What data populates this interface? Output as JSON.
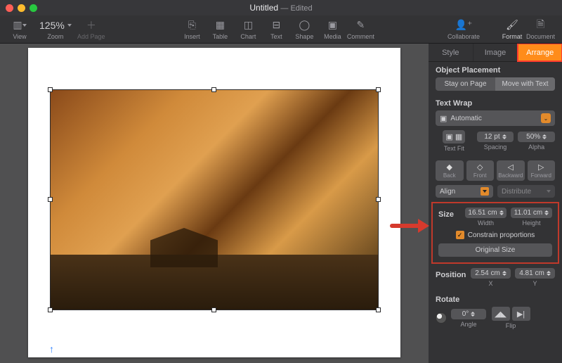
{
  "title": {
    "name": "Untitled",
    "status": "Edited"
  },
  "toolbar": {
    "view": "View",
    "zoom": "Zoom",
    "zoom_value": "125%",
    "add_page": "Add Page",
    "insert": "Insert",
    "table": "Table",
    "chart": "Chart",
    "text": "Text",
    "shape": "Shape",
    "media": "Media",
    "comment": "Comment",
    "collaborate": "Collaborate",
    "format": "Format",
    "document": "Document"
  },
  "inspector": {
    "tabs": {
      "style": "Style",
      "image": "Image",
      "arrange": "Arrange"
    },
    "object_placement": {
      "title": "Object Placement",
      "stay": "Stay on Page",
      "move": "Move with Text"
    },
    "text_wrap": {
      "title": "Text Wrap",
      "mode": "Automatic",
      "text_fit": "Text Fit",
      "spacing_label": "Spacing",
      "spacing_value": "12 pt",
      "alpha_label": "Alpha",
      "alpha_value": "50%"
    },
    "layers": {
      "back": "Back",
      "front": "Front",
      "backward": "Backward",
      "forward": "Forward"
    },
    "align": {
      "align": "Align",
      "distribute": "Distribute"
    },
    "size": {
      "title": "Size",
      "width_value": "16.51 cm",
      "width_label": "Width",
      "height_value": "11.01 cm",
      "height_label": "Height",
      "constrain": "Constrain proportions",
      "original": "Original Size"
    },
    "position": {
      "title": "Position",
      "x_value": "2.54 cm",
      "x_label": "X",
      "y_value": "4.81 cm",
      "y_label": "Y"
    },
    "rotate": {
      "title": "Rotate",
      "angle_value": "0°",
      "angle_label": "Angle",
      "flip_label": "Flip"
    }
  }
}
